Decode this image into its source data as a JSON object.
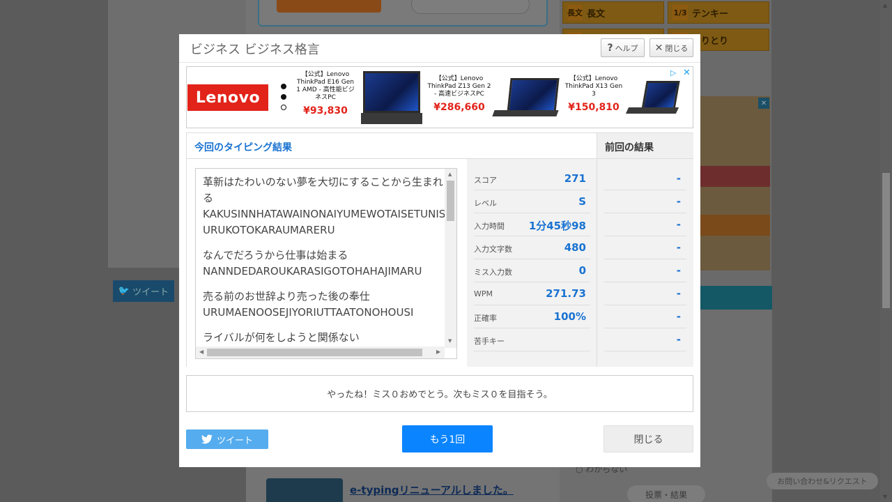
{
  "background": {
    "tiles": [
      {
        "icon": "長文",
        "label": "長文"
      },
      {
        "icon": "1/3",
        "label": "テンキー"
      },
      {
        "icon": "",
        "label": ""
      },
      {
        "icon": "",
        "label": "しりとり"
      }
    ],
    "tweet_label": "ツイート",
    "radio_label": "わからない",
    "vote_label": "投票・結果",
    "news_link": "e-typingリニューアルしました。",
    "contact_label": "お問い合わせ&リクエスト"
  },
  "modal": {
    "title": "ビジネス ビジネス格言",
    "help_label": "ヘルプ",
    "close_top_label": "閉じる"
  },
  "ad": {
    "brand": "Lenovo",
    "products": [
      {
        "name": "【公式】Lenovo ThinkPad E16 Gen 1 AMD - 高性能ビジネスPC",
        "price": "¥93,830"
      },
      {
        "name": "【公式】Lenovo ThinkPad Z13 Gen 2 - 高速ビジネスPC",
        "price": "¥286,660"
      },
      {
        "name": "【公式】Lenovo ThinkPad X13 Gen 3",
        "price": "¥150,810"
      }
    ]
  },
  "results": {
    "current_header": "今回のタイピング結果",
    "previous_header": "前回の結果",
    "passages": [
      {
        "kana": "革新はたわいのない夢を大切にすることから生まれる",
        "roma": "KAKUSINNHATAWAINONAIYUMEWOTAISETUNISURUKOTOKARAUMARERU"
      },
      {
        "kana": "なんでだろうから仕事は始まる",
        "roma": "NANNDEDAROUKARASIGOTOHAHAJIMARU"
      },
      {
        "kana": "売る前のお世辞より売った後の奉仕",
        "roma": "URUMAENOOSEJIYORIUTTAATONOHOUSI"
      },
      {
        "kana": "ライバルが何をしようと関係ない",
        "roma": ""
      }
    ],
    "stats": [
      {
        "label": "スコア",
        "value": "271",
        "prev": "-"
      },
      {
        "label": "レベル",
        "value": "S",
        "prev": "-"
      },
      {
        "label": "入力時間",
        "value": "1分45秒98",
        "prev": "-"
      },
      {
        "label": "入力文字数",
        "value": "480",
        "prev": "-"
      },
      {
        "label": "ミス入力数",
        "value": "0",
        "prev": "-"
      },
      {
        "label": "WPM",
        "value": "271.73",
        "prev": "-"
      },
      {
        "label": "正確率",
        "value": "100%",
        "prev": "-"
      },
      {
        "label": "苦手キー",
        "value": "",
        "prev": "-"
      }
    ]
  },
  "message": "やったね！ミス０おめでとう。次もミス０を目指そう。",
  "buttons": {
    "tweet": "ツイート",
    "retry": "もう1回",
    "close": "閉じる"
  },
  "colors": {
    "accent": "#0a84ff",
    "link_blue": "#1a73d1",
    "twitter": "#55acee",
    "lenovo_red": "#e2231a"
  }
}
